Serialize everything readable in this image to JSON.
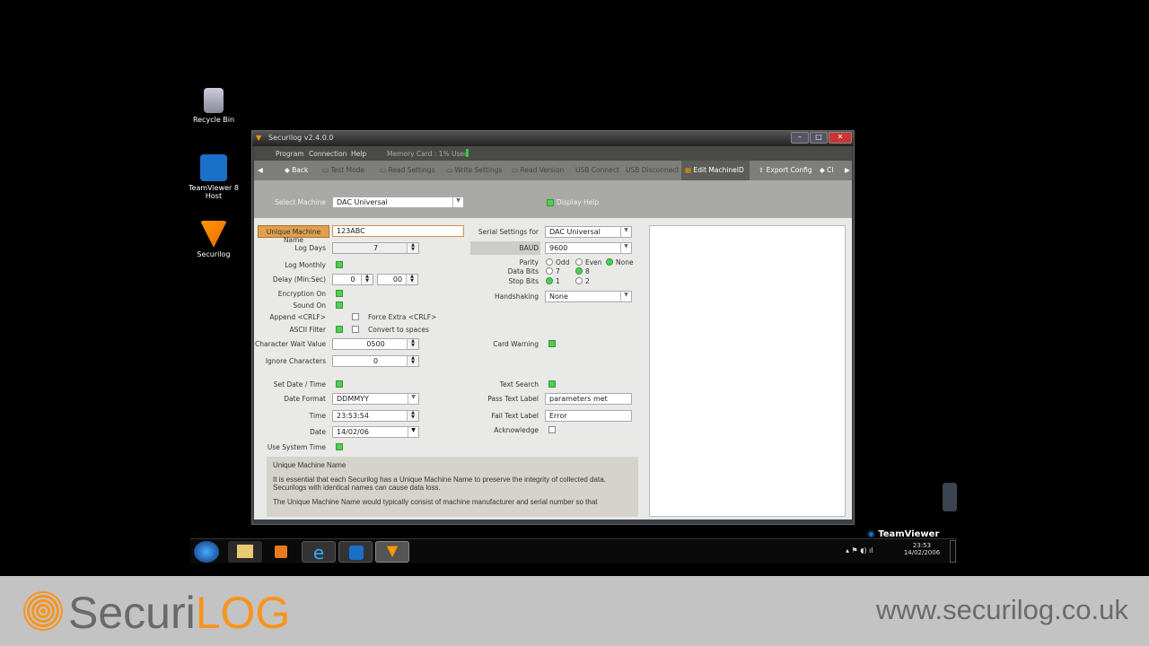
{
  "desktop": {
    "icons": [
      {
        "label": "Recycle Bin"
      },
      {
        "label": "TeamViewer 8 Host"
      },
      {
        "label": "Securilog"
      }
    ]
  },
  "window": {
    "title": "Securilog  v2.4.0.0",
    "menu": [
      "Program",
      "Connection",
      "Help"
    ],
    "memory_card": "Memory Card : 1% Used",
    "toolbar": [
      "Back",
      "Test Mode",
      "Read Settings",
      "Write Settings",
      "Read Version",
      "Connect",
      "Disconnect",
      "Edit MachineID",
      "Export Config",
      "Cl"
    ],
    "usb_label": "USB",
    "select_machine_label": "Select Machine",
    "select_machine_value": "DAC Universal",
    "display_help": "Display Help",
    "left": {
      "unique_name_label": "Unique Machine Name",
      "unique_name_value": "123ABC",
      "log_days_label": "Log Days",
      "log_days_value": "7",
      "log_monthly_label": "Log Monthly",
      "delay_label": "Delay (Min:Sec)",
      "delay_min": "0",
      "delay_sec": "00",
      "encryption_label": "Encryption On",
      "sound_label": "Sound On",
      "append_label": "Append <CRLF>",
      "force_extra_label": "Force Extra <CRLF>",
      "ascii_label": "ASCII Filter",
      "convert_label": "Convert to spaces",
      "char_wait_label": "Character Wait Value",
      "char_wait_value": "0500",
      "ignore_label": "Ignore Characters",
      "ignore_value": "0",
      "set_date_label": "Set Date / Time",
      "date_format_label": "Date Format",
      "date_format_value": "DDMMYY",
      "time_label": "Time",
      "time_value": "23:53:54",
      "date_label": "Date",
      "date_value": "14/02/06",
      "use_system_label": "Use System Time"
    },
    "right": {
      "serial_label": "Serial Settings for",
      "serial_value": "DAC Universal",
      "baud_label": "BAUD",
      "baud_value": "9600",
      "parity_label": "Parity",
      "parity_options": [
        "Odd",
        "Even",
        "None"
      ],
      "data_bits_label": "Data Bits",
      "data_bits_options": [
        "7",
        "8"
      ],
      "stop_bits_label": "Stop Bits",
      "stop_bits_options": [
        "1",
        "2"
      ],
      "handshaking_label": "Handshaking",
      "handshaking_value": "None",
      "card_warning_label": "Card Warning",
      "text_search_label": "Text Search",
      "pass_label": "Pass Text Label",
      "pass_value": "parameters met",
      "fail_label": "Fail Text Label",
      "fail_value": "Error",
      "acknowledge_label": "Acknowledge"
    },
    "help": {
      "title": "Unique Machine Name",
      "p1": "It is essential that each Securilog has a Unique Machine Name to preserve the integrity of collected data. Securilogs with identical names can cause data loss.",
      "p2": "The Unique Machine Name would typically consist of machine manufacturer and serial number so that"
    }
  },
  "taskbar": {
    "clock_time": "23:53",
    "clock_date": "14/02/2006",
    "teamviewer": "TeamViewer"
  },
  "banner": {
    "logo": "SecuriLOG",
    "url": "www.securilog.co.uk"
  }
}
